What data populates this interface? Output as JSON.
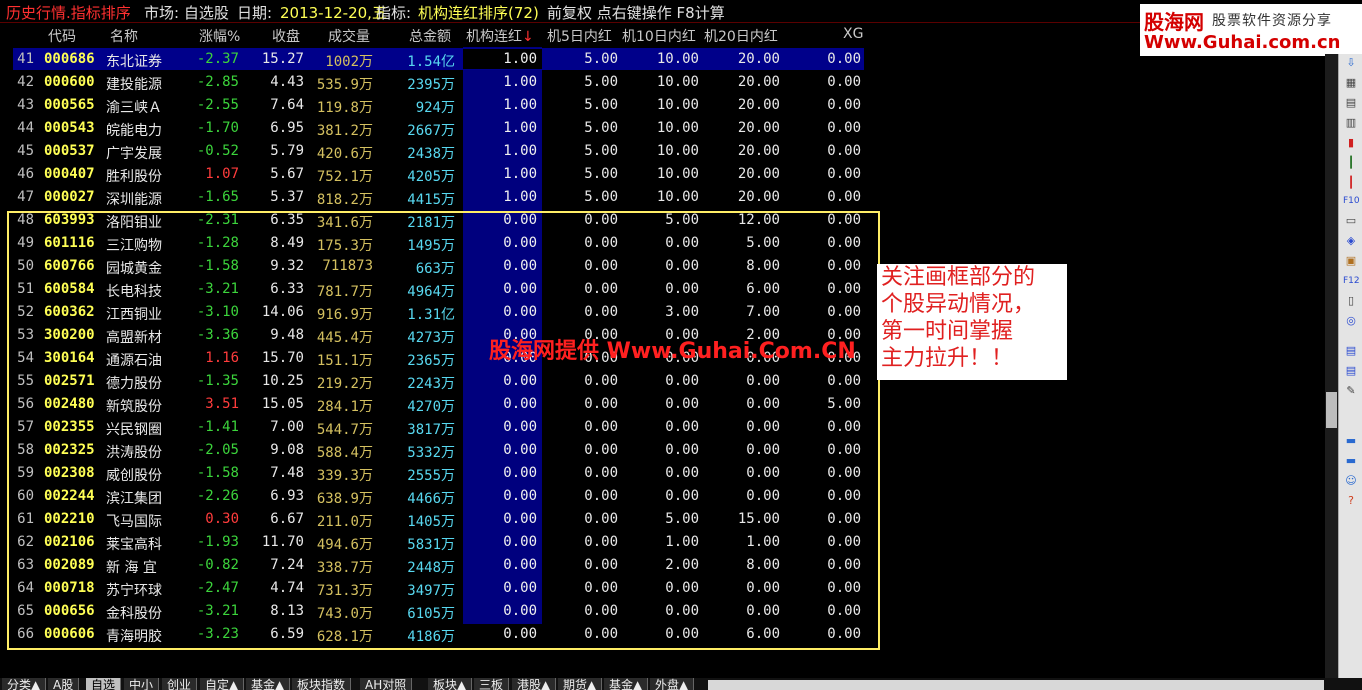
{
  "titlebar": {
    "title": "历史行情.指标排序",
    "market": "市场: 自选股",
    "date_label": "日期:",
    "date": "2013-12-20,五",
    "indicator_label": "指标:",
    "indicator": "机构连红排序(72)",
    "ops": "前复权 点右键操作 F8计算"
  },
  "logo": {
    "brand": "股海网",
    "slogan": "股票软件资源分享",
    "url": "Www.Guhai.com.cn"
  },
  "columns": {
    "code": "代码",
    "name": "名称",
    "change": "涨幅%",
    "close": "收盘",
    "volume": "成交量",
    "amount": "总金额",
    "red": "机构连红",
    "sort_arrow": "↓",
    "d5": "机5日内红",
    "d10": "机10日内红",
    "d20": "机20日内红",
    "xg": "XG"
  },
  "rows": [
    {
      "num": "41",
      "code": "000686",
      "name": "东北证券",
      "chg": "-2.37",
      "close": "15.27",
      "vol": "1002万",
      "amt": "1.54亿",
      "red": "1.00",
      "d5": "5.00",
      "d10": "10.00",
      "d20": "20.00",
      "xg": "0.00"
    },
    {
      "num": "42",
      "code": "000600",
      "name": "建投能源",
      "chg": "-2.85",
      "close": "4.43",
      "vol": "535.9万",
      "amt": "2395万",
      "red": "1.00",
      "d5": "5.00",
      "d10": "10.00",
      "d20": "20.00",
      "xg": "0.00"
    },
    {
      "num": "43",
      "code": "000565",
      "name": "渝三峡Ａ",
      "chg": "-2.55",
      "close": "7.64",
      "vol": "119.8万",
      "amt": "924万",
      "red": "1.00",
      "d5": "5.00",
      "d10": "10.00",
      "d20": "20.00",
      "xg": "0.00"
    },
    {
      "num": "44",
      "code": "000543",
      "name": "皖能电力",
      "chg": "-1.70",
      "close": "6.95",
      "vol": "381.2万",
      "amt": "2667万",
      "red": "1.00",
      "d5": "5.00",
      "d10": "10.00",
      "d20": "20.00",
      "xg": "0.00"
    },
    {
      "num": "45",
      "code": "000537",
      "name": "广宇发展",
      "chg": "-0.52",
      "close": "5.79",
      "vol": "420.6万",
      "amt": "2438万",
      "red": "1.00",
      "d5": "5.00",
      "d10": "10.00",
      "d20": "20.00",
      "xg": "0.00"
    },
    {
      "num": "46",
      "code": "000407",
      "name": "胜利股份",
      "chg": "1.07",
      "close": "5.67",
      "vol": "752.1万",
      "amt": "4205万",
      "red": "1.00",
      "d5": "5.00",
      "d10": "10.00",
      "d20": "20.00",
      "xg": "0.00"
    },
    {
      "num": "47",
      "code": "000027",
      "name": "深圳能源",
      "chg": "-1.65",
      "close": "5.37",
      "vol": "818.2万",
      "amt": "4415万",
      "red": "1.00",
      "d5": "5.00",
      "d10": "10.00",
      "d20": "20.00",
      "xg": "0.00"
    },
    {
      "num": "48",
      "code": "603993",
      "name": "洛阳钼业",
      "chg": "-2.31",
      "close": "6.35",
      "vol": "341.6万",
      "amt": "2181万",
      "red": "0.00",
      "d5": "0.00",
      "d10": "5.00",
      "d20": "12.00",
      "xg": "0.00"
    },
    {
      "num": "49",
      "code": "601116",
      "name": "三江购物",
      "chg": "-1.28",
      "close": "8.49",
      "vol": "175.3万",
      "amt": "1495万",
      "red": "0.00",
      "d5": "0.00",
      "d10": "0.00",
      "d20": "5.00",
      "xg": "0.00"
    },
    {
      "num": "50",
      "code": "600766",
      "name": "园城黄金",
      "chg": "-1.58",
      "close": "9.32",
      "vol": "711873",
      "amt": "663万",
      "red": "0.00",
      "d5": "0.00",
      "d10": "0.00",
      "d20": "8.00",
      "xg": "0.00"
    },
    {
      "num": "51",
      "code": "600584",
      "name": "长电科技",
      "chg": "-3.21",
      "close": "6.33",
      "vol": "781.7万",
      "amt": "4964万",
      "red": "0.00",
      "d5": "0.00",
      "d10": "0.00",
      "d20": "6.00",
      "xg": "0.00"
    },
    {
      "num": "52",
      "code": "600362",
      "name": "江西铜业",
      "chg": "-3.10",
      "close": "14.06",
      "vol": "916.9万",
      "amt": "1.31亿",
      "red": "0.00",
      "d5": "0.00",
      "d10": "3.00",
      "d20": "7.00",
      "xg": "0.00"
    },
    {
      "num": "53",
      "code": "300200",
      "name": "高盟新材",
      "chg": "-3.36",
      "close": "9.48",
      "vol": "445.4万",
      "amt": "4273万",
      "red": "0.00",
      "d5": "0.00",
      "d10": "0.00",
      "d20": "2.00",
      "xg": "0.00"
    },
    {
      "num": "54",
      "code": "300164",
      "name": "通源石油",
      "chg": "1.16",
      "close": "15.70",
      "vol": "151.1万",
      "amt": "2365万",
      "red": "0.00",
      "d5": "0.00",
      "d10": "0.00",
      "d20": "0.00",
      "xg": "0.00"
    },
    {
      "num": "55",
      "code": "002571",
      "name": "德力股份",
      "chg": "-1.35",
      "close": "10.25",
      "vol": "219.2万",
      "amt": "2243万",
      "red": "0.00",
      "d5": "0.00",
      "d10": "0.00",
      "d20": "0.00",
      "xg": "0.00"
    },
    {
      "num": "56",
      "code": "002480",
      "name": "新筑股份",
      "chg": "3.51",
      "close": "15.05",
      "vol": "284.1万",
      "amt": "4270万",
      "red": "0.00",
      "d5": "0.00",
      "d10": "0.00",
      "d20": "0.00",
      "xg": "5.00"
    },
    {
      "num": "57",
      "code": "002355",
      "name": "兴民钢圈",
      "chg": "-1.41",
      "close": "7.00",
      "vol": "544.7万",
      "amt": "3817万",
      "red": "0.00",
      "d5": "0.00",
      "d10": "0.00",
      "d20": "0.00",
      "xg": "0.00"
    },
    {
      "num": "58",
      "code": "002325",
      "name": "洪涛股份",
      "chg": "-2.05",
      "close": "9.08",
      "vol": "588.4万",
      "amt": "5332万",
      "red": "0.00",
      "d5": "0.00",
      "d10": "0.00",
      "d20": "0.00",
      "xg": "0.00"
    },
    {
      "num": "59",
      "code": "002308",
      "name": "威创股份",
      "chg": "-1.58",
      "close": "7.48",
      "vol": "339.3万",
      "amt": "2555万",
      "red": "0.00",
      "d5": "0.00",
      "d10": "0.00",
      "d20": "0.00",
      "xg": "0.00"
    },
    {
      "num": "60",
      "code": "002244",
      "name": "滨江集团",
      "chg": "-2.26",
      "close": "6.93",
      "vol": "638.9万",
      "amt": "4466万",
      "red": "0.00",
      "d5": "0.00",
      "d10": "0.00",
      "d20": "0.00",
      "xg": "0.00"
    },
    {
      "num": "61",
      "code": "002210",
      "name": "飞马国际",
      "chg": "0.30",
      "close": "6.67",
      "vol": "211.0万",
      "amt": "1405万",
      "red": "0.00",
      "d5": "0.00",
      "d10": "5.00",
      "d20": "15.00",
      "xg": "0.00"
    },
    {
      "num": "62",
      "code": "002106",
      "name": "莱宝高科",
      "chg": "-1.93",
      "close": "11.70",
      "vol": "494.6万",
      "amt": "5831万",
      "red": "0.00",
      "d5": "0.00",
      "d10": "1.00",
      "d20": "1.00",
      "xg": "0.00"
    },
    {
      "num": "63",
      "code": "002089",
      "name": "新 海 宜",
      "chg": "-0.82",
      "close": "7.24",
      "vol": "338.7万",
      "amt": "2448万",
      "red": "0.00",
      "d5": "0.00",
      "d10": "2.00",
      "d20": "8.00",
      "xg": "0.00"
    },
    {
      "num": "64",
      "code": "000718",
      "name": "苏宁环球",
      "chg": "-2.47",
      "close": "4.74",
      "vol": "731.3万",
      "amt": "3497万",
      "red": "0.00",
      "d5": "0.00",
      "d10": "0.00",
      "d20": "0.00",
      "xg": "0.00"
    },
    {
      "num": "65",
      "code": "000656",
      "name": "金科股份",
      "chg": "-3.21",
      "close": "8.13",
      "vol": "743.0万",
      "amt": "6105万",
      "red": "0.00",
      "d5": "0.00",
      "d10": "0.00",
      "d20": "0.00",
      "xg": "0.00"
    },
    {
      "num": "66",
      "code": "000606",
      "name": "青海明胶",
      "chg": "-3.23",
      "close": "6.59",
      "vol": "628.1万",
      "amt": "4186万",
      "red": "0.00",
      "d5": "0.00",
      "d10": "0.00",
      "d20": "6.00",
      "xg": "0.00"
    }
  ],
  "annotation": {
    "line1": "关注画框部分的",
    "line2": "个股异动情况，",
    "line3": "第一时间掌握",
    "line4": "主力拉升！！"
  },
  "watermark": "股海网提供 Www.Guhai.Com.CN",
  "tabs": [
    "分类▲",
    "A股",
    "自选",
    "中小",
    "创业",
    "自定▲",
    "基金▲",
    "板块指数",
    "AH对照",
    "板块▲",
    "三板",
    "港股▲",
    "期货▲",
    "基金▲",
    "外盘▲"
  ],
  "active_tab": "自选",
  "colors": {
    "background": "#000000",
    "sort_column": "#00007e",
    "negative": "#3cd43c",
    "positive": "#ff3c3c",
    "code": "#ffff55",
    "amount": "#58d8f0",
    "frame": "#ffee66",
    "annotation": "#e02020"
  },
  "right_toolbar_icons": [
    "arrow-down-icon",
    "grid-icon",
    "table-icon",
    "list-icon",
    "bar-chart-icon",
    "candle-icon",
    "candle-red-icon",
    "f10-icon",
    "note-icon",
    "fund-icon",
    "book-icon",
    "f12-icon",
    "doc-icon",
    "circle-icon",
    "page-icon",
    "page2-icon",
    "edit-icon",
    "folder-icon",
    "folder2-icon",
    "person-icon",
    "help-icon"
  ]
}
